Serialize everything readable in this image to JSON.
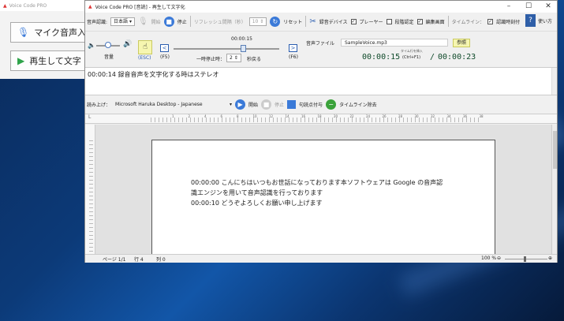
{
  "background_window": {
    "title": "Voice Code PRO",
    "buttons": [
      {
        "label": "マイク音声入"
      },
      {
        "label": "再生して文字"
      }
    ]
  },
  "window": {
    "title": "Voice Code PRO [音読] - 再生して文字化",
    "toolbar": {
      "recognition_label": "音声認識:",
      "language_value": "日本語",
      "start_label": "開始",
      "stop_label": "停止",
      "refresh_label": "リフレッシュ間隔（秒）",
      "refresh_value": "10",
      "reset_label": "リセット",
      "device_label": "録音デバイス",
      "player_label": "プレーヤー",
      "sync_label": "段階認定",
      "edit_label": "編集画面",
      "timeline_label": "タイムライン：",
      "time_mark_label": "認識時刻付",
      "help_label": "使い方"
    },
    "player": {
      "volume_label": "音量",
      "esc_label": "(ESC)",
      "f5_label": "(F5)",
      "f6_label": "(F6)",
      "position_time": "00:00:15",
      "pause_label": "一時停止時：",
      "pause_value": "2",
      "pause_suffix": "秒戻る",
      "file_label": "音声ファイル",
      "file_value": "SampleVoice.mp3",
      "ref_button": "参照",
      "current_time": "00:00:15",
      "insert_label": "タイム行を挿入",
      "insert_shortcut": "(Ctrl+F1)",
      "separator": "/",
      "total_time": "00:00:23"
    },
    "recognition_text": "00:00:14  録音音声を文字化する時はステレオ",
    "readaloud": {
      "label": "読み上げ：",
      "voice_value": "Microsoft Haruka Desktop - Japanese",
      "start_label": "開始",
      "stop_label": "停止",
      "punct_label": "句読点付与",
      "timeline_remove_label": "タイムライン除去"
    },
    "ruler_marks": [
      "1",
      "2",
      "4",
      "6",
      "8",
      "10",
      "12",
      "14",
      "16",
      "18",
      "20",
      "22",
      "24",
      "26",
      "28",
      "30",
      "32",
      "34",
      "36",
      "38"
    ],
    "document": {
      "lines": [
        "00:00:00  こんにちはいつもお世話になっております本ソフトウェアは Google の音声認",
        "識エンジンを用いて音声認識を行っております",
        "00:00:10  どうぞよろしくお願い申し上げます"
      ]
    },
    "statusbar": {
      "page": "ページ 1/1",
      "line": "行 4",
      "column": "列 0",
      "zoom": "100 %"
    }
  }
}
